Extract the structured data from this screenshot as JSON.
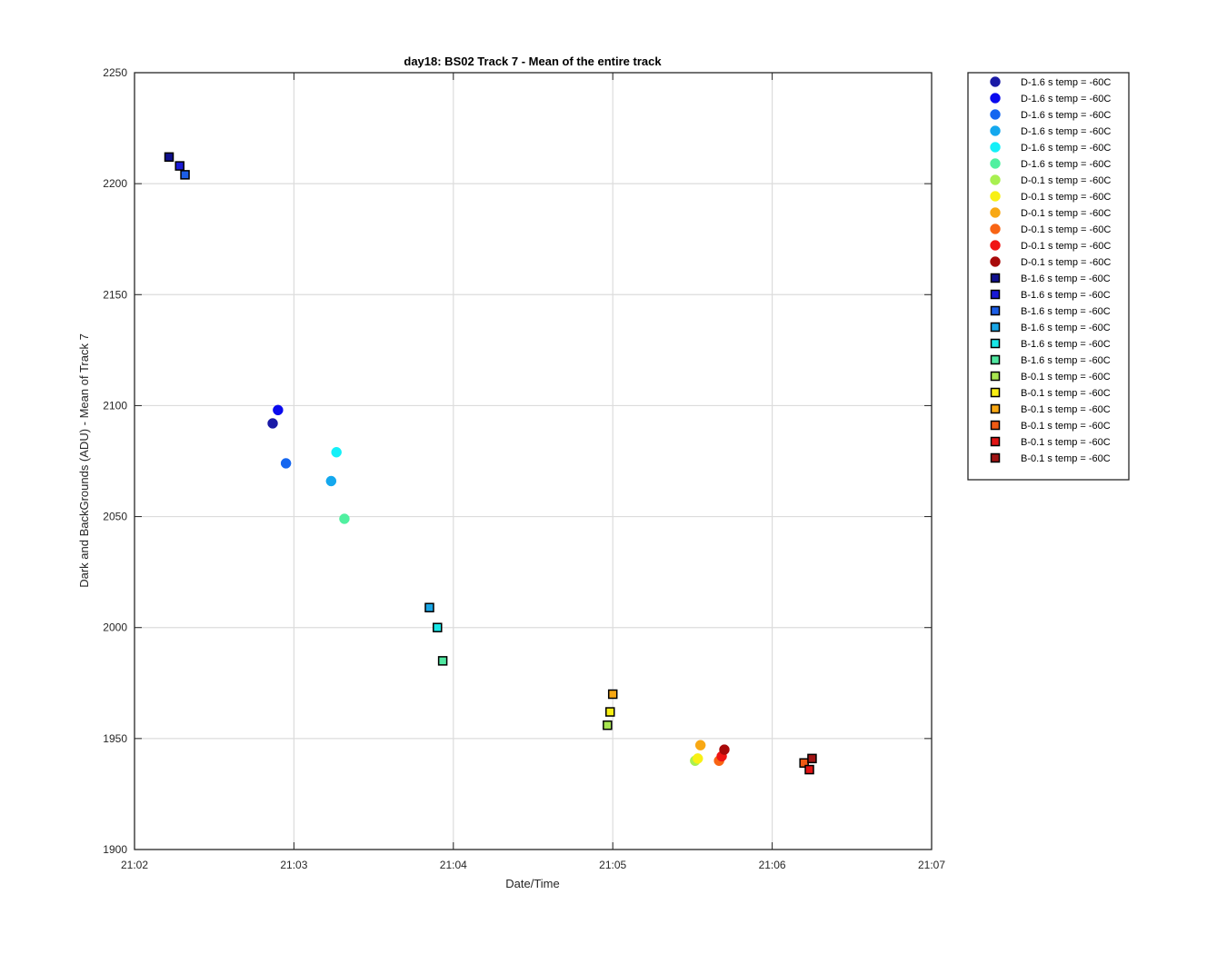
{
  "chart_data": {
    "type": "scatter",
    "title": "day18: BS02  Track 7 - Mean of the entire track",
    "xlabel": "Date/Time",
    "ylabel": "Dark and BackGrounds (ADU) - Mean of Track 7",
    "x_tick_labels": [
      "21:02",
      "21:03",
      "21:04",
      "21:05",
      "21:06",
      "21:07"
    ],
    "x_ticks": [
      "21:02:00",
      "21:03:00",
      "21:04:00",
      "21:05:00",
      "21:06:00",
      "21:07:00"
    ],
    "xlim": [
      "21:02:00",
      "21:07:00"
    ],
    "ylim": [
      1900,
      2250
    ],
    "y_ticks": [
      1900,
      1950,
      2000,
      2050,
      2100,
      2150,
      2200,
      2250
    ],
    "grid": true,
    "legend_position": "outside-right",
    "series": [
      {
        "name": "D-1.6 s temp = -60C",
        "marker": "circle",
        "color": "#1a1aa6",
        "points": [
          {
            "x": "21:02:52",
            "y": 2092
          }
        ]
      },
      {
        "name": "D-1.6 s temp = -60C",
        "marker": "circle",
        "color": "#0a0aee",
        "points": [
          {
            "x": "21:02:54",
            "y": 2098
          }
        ]
      },
      {
        "name": "D-1.6 s temp = -60C",
        "marker": "circle",
        "color": "#1466f0",
        "points": [
          {
            "x": "21:02:57",
            "y": 2074
          }
        ]
      },
      {
        "name": "D-1.6 s temp = -60C",
        "marker": "circle",
        "color": "#14a8ee",
        "points": [
          {
            "x": "21:03:14",
            "y": 2066
          }
        ]
      },
      {
        "name": "D-1.6 s temp = -60C",
        "marker": "circle",
        "color": "#14f0f8",
        "points": [
          {
            "x": "21:03:16",
            "y": 2079
          }
        ]
      },
      {
        "name": "D-1.6 s temp = -60C",
        "marker": "circle",
        "color": "#50f0a0",
        "points": [
          {
            "x": "21:03:19",
            "y": 2049
          }
        ]
      },
      {
        "name": "D-0.1 s temp = -60C",
        "marker": "circle",
        "color": "#a8f050",
        "points": [
          {
            "x": "21:05:31",
            "y": 1940
          }
        ]
      },
      {
        "name": "D-0.1 s temp = -60C",
        "marker": "circle",
        "color": "#f8f014",
        "points": [
          {
            "x": "21:05:32",
            "y": 1941
          }
        ]
      },
      {
        "name": "D-0.1 s temp = -60C",
        "marker": "circle",
        "color": "#f8a814",
        "points": [
          {
            "x": "21:05:33",
            "y": 1947
          }
        ]
      },
      {
        "name": "D-0.1 s temp = -60C",
        "marker": "circle",
        "color": "#f86414",
        "points": [
          {
            "x": "21:05:40",
            "y": 1940
          }
        ]
      },
      {
        "name": "D-0.1 s temp = -60C",
        "marker": "circle",
        "color": "#f01414",
        "points": [
          {
            "x": "21:05:41",
            "y": 1942
          }
        ]
      },
      {
        "name": "D-0.1 s temp = -60C",
        "marker": "circle",
        "color": "#a80a0a",
        "points": [
          {
            "x": "21:05:42",
            "y": 1945
          }
        ]
      },
      {
        "name": "B-1.6 s temp = -60C",
        "marker": "square",
        "color": "#10108e",
        "points": [
          {
            "x": "21:02:13",
            "y": 2212
          }
        ]
      },
      {
        "name": "B-1.6 s temp = -60C",
        "marker": "square",
        "color": "#1a1ad6",
        "points": [
          {
            "x": "21:02:17",
            "y": 2208
          }
        ]
      },
      {
        "name": "B-1.6 s temp = -60C",
        "marker": "square",
        "color": "#1c5ee6",
        "points": [
          {
            "x": "21:02:19",
            "y": 2204
          }
        ]
      },
      {
        "name": "B-1.6 s temp = -60C",
        "marker": "square",
        "color": "#1aa6e6",
        "points": [
          {
            "x": "21:03:51",
            "y": 2009
          }
        ]
      },
      {
        "name": "B-1.6 s temp = -60C",
        "marker": "square",
        "color": "#1ae6e6",
        "points": [
          {
            "x": "21:03:54",
            "y": 2000
          }
        ]
      },
      {
        "name": "B-1.6 s temp = -60C",
        "marker": "square",
        "color": "#50e6a0",
        "points": [
          {
            "x": "21:03:56",
            "y": 1985
          }
        ]
      },
      {
        "name": "B-0.1 s temp = -60C",
        "marker": "square",
        "color": "#a8e650",
        "points": [
          {
            "x": "21:04:58",
            "y": 1956
          }
        ]
      },
      {
        "name": "B-0.1 s temp = -60C",
        "marker": "square",
        "color": "#f8ee14",
        "points": [
          {
            "x": "21:04:59",
            "y": 1962
          }
        ]
      },
      {
        "name": "B-0.1 s temp = -60C",
        "marker": "square",
        "color": "#f8a814",
        "points": [
          {
            "x": "21:05:00",
            "y": 1970
          }
        ]
      },
      {
        "name": "B-0.1 s temp = -60C",
        "marker": "square",
        "color": "#f05a14",
        "points": [
          {
            "x": "21:06:12",
            "y": 1939
          }
        ]
      },
      {
        "name": "B-0.1 s temp = -60C",
        "marker": "square",
        "color": "#e01414",
        "points": [
          {
            "x": "21:06:14",
            "y": 1936
          }
        ]
      },
      {
        "name": "B-0.1 s temp = -60C",
        "marker": "square",
        "color": "#a01414",
        "points": [
          {
            "x": "21:06:15",
            "y": 1941
          }
        ]
      }
    ]
  }
}
